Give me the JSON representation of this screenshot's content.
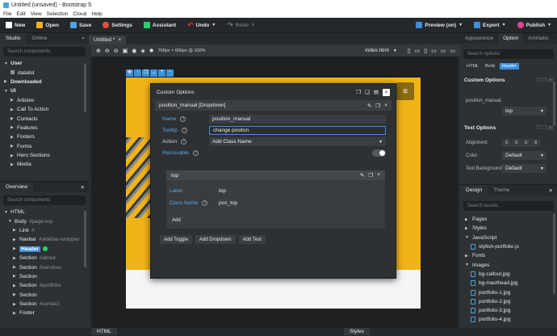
{
  "window": {
    "title": "Untitled (unsaved) - Bootstrap S"
  },
  "menubar": [
    "File",
    "Edit",
    "View",
    "Selection",
    "Cloud",
    "Help"
  ],
  "toolbar": {
    "new": "New",
    "open": "Open",
    "save": "Save",
    "settings": "Settings",
    "assistant": "Assistant",
    "undo": "Undo",
    "redo": "Redo",
    "preview": "Preview (on)",
    "export": "Export",
    "publish": "Publish"
  },
  "left_top": {
    "tabs": [
      "Studio",
      "Online"
    ],
    "search_placeholder": "Search components",
    "items": [
      {
        "label": "User",
        "expanded": true
      },
      {
        "label": "datalist",
        "child": true
      },
      {
        "label": "Downloaded",
        "expanded": false
      },
      {
        "label": "UI",
        "expanded": true
      },
      {
        "label": "Articles"
      },
      {
        "label": "Call To Action"
      },
      {
        "label": "Contacts"
      },
      {
        "label": "Features"
      },
      {
        "label": "Footers"
      },
      {
        "label": "Forms"
      },
      {
        "label": "Hero Sections"
      },
      {
        "label": "Media"
      }
    ]
  },
  "left_bottom": {
    "title": "Overview",
    "search_placeholder": "Search components",
    "items": [
      {
        "label": "HTML",
        "extra": ""
      },
      {
        "label": "Body",
        "extra": "#page-top"
      },
      {
        "label": "Link",
        "extra": "#"
      },
      {
        "label": "Navbar",
        "extra": "#sidebar-wrapper"
      },
      {
        "label": "Header",
        "extra": ""
      },
      {
        "label": "Section",
        "extra": "#about"
      },
      {
        "label": "Section",
        "extra": "#services"
      },
      {
        "label": "Section",
        "extra": ""
      },
      {
        "label": "Section",
        "extra": "#portfolio"
      },
      {
        "label": "Section",
        "extra": ""
      },
      {
        "label": "Section",
        "extra": "#contact"
      },
      {
        "label": "Footer",
        "extra": ""
      }
    ]
  },
  "doc_tab": "Untitled *",
  "canvas_bar": {
    "size": "768px × 600px @ 100%",
    "file": "index.html"
  },
  "dialog": {
    "title": "Custom Options",
    "component": "position_manual [Dropdown]",
    "name_label": "Name",
    "name_value": "position_manual",
    "tooltip_label": "Tooltip",
    "tooltip_value": "change positon",
    "action_label": "Action",
    "action_value": "Add Class Name",
    "removable_label": "Removable",
    "option": {
      "title": "top",
      "label_label": "Label",
      "label_value": "top",
      "class_label": "Class Name",
      "class_value": "pos_top",
      "add": "Add"
    },
    "buttons": [
      "Add Toggle",
      "Add Dropdown",
      "Add Text"
    ]
  },
  "right": {
    "tabs": [
      "Appearance",
      "Option",
      "Animatio"
    ],
    "search_placeholder": "Search options",
    "chips": [
      "HTML",
      "Body",
      "Header"
    ],
    "custom_options_title": "Custom Options",
    "position_label": "position_manual",
    "position_value": "top",
    "text_options_title": "Text Options",
    "alignment_label": "Alignment",
    "color_label": "Color",
    "color_value": "Default",
    "bg_label": "Text Background",
    "bg_value": "Default",
    "design_tabs": [
      "Design",
      "Theme"
    ],
    "assets_placeholder": "Search assets",
    "folders": [
      "Pages",
      "Styles",
      "JavaScript"
    ],
    "js_file": "stylish-portfolio.js",
    "folders2": [
      "Fonts",
      "Images"
    ],
    "images": [
      "bg-callout.jpg",
      "bg-masthead.jpg",
      "portfolio-1.jpg",
      "portfolio-2.jpg",
      "portfolio-3.jpg",
      "portfolio-4.jpg"
    ]
  },
  "statusbar": {
    "html": "HTML",
    "styles": "Styles"
  },
  "colors": {
    "accent": "#3c8fde",
    "yellow": "#f1b418",
    "green": "#2ecc71"
  }
}
